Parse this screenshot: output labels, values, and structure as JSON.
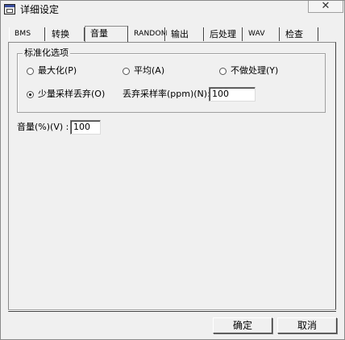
{
  "window": {
    "title": "详细设定",
    "close_glyph": "✕"
  },
  "tabs": [
    {
      "label": "BMS"
    },
    {
      "label": "转换"
    },
    {
      "label": "音量"
    },
    {
      "label": "RANDOM"
    },
    {
      "label": "输出"
    },
    {
      "label": "后处理"
    },
    {
      "label": "WAV"
    },
    {
      "label": "检查"
    }
  ],
  "active_tab": "音量",
  "normalize_group": {
    "label": "标准化选项",
    "options": [
      {
        "label": "最大化(P)",
        "checked": false
      },
      {
        "label": "平均(A)",
        "checked": false
      },
      {
        "label": "不做处理(Y)",
        "checked": false
      },
      {
        "label": "少量采样丢弃(O)",
        "checked": true
      }
    ],
    "discard_rate_label": "丢弃采样率(ppm)(N):",
    "discard_rate_value": "100"
  },
  "volume": {
    "label": "音量(%)(V) :",
    "value": "100"
  },
  "buttons": {
    "ok": "确定",
    "cancel": "取消"
  }
}
